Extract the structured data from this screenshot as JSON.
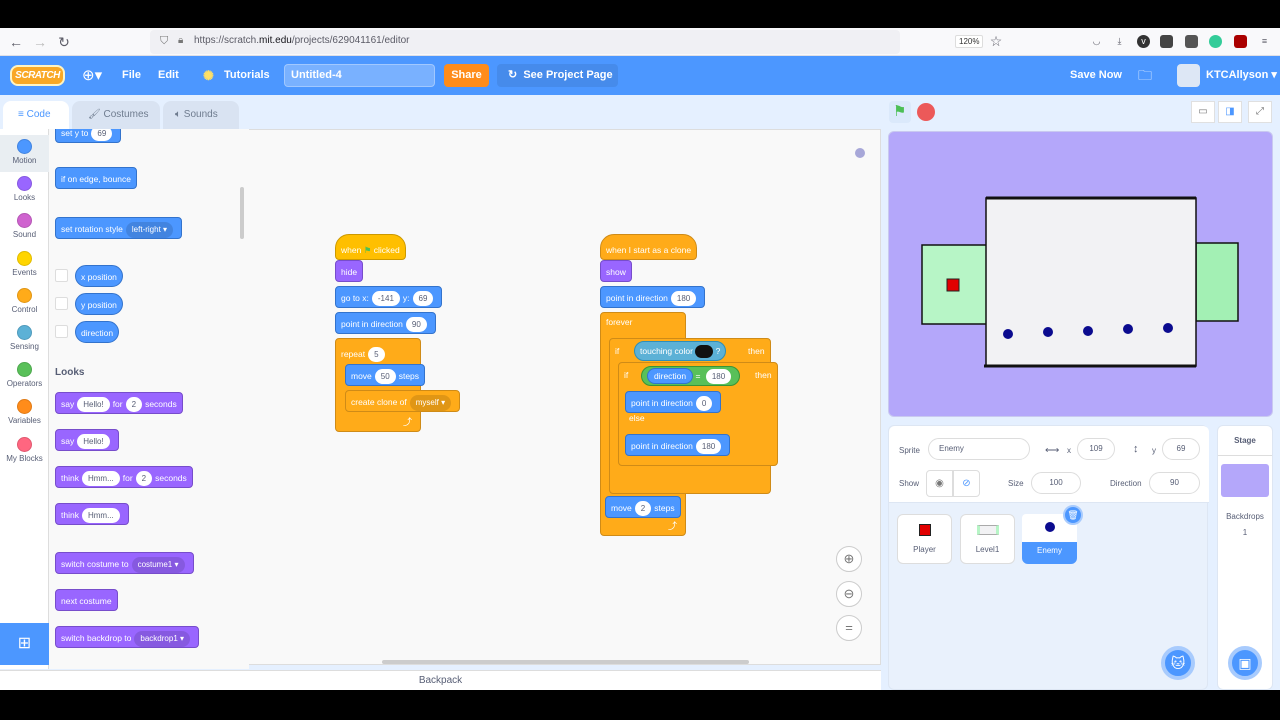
{
  "browser": {
    "url_prefix": "https://scratch.",
    "url_domain": "mit.edu",
    "url_path": "/projects/629041161/editor",
    "zoom_level": "120%"
  },
  "menubar": {
    "logo": "SCRATCH",
    "file": "File",
    "edit": "Edit",
    "tutorials": "Tutorials",
    "project_title": "Untitled-4",
    "share": "Share",
    "see_project_page": "See Project Page",
    "save_now": "Save Now",
    "username": "KTCAllyson"
  },
  "tabs": {
    "code": "Code",
    "costumes": "Costumes",
    "sounds": "Sounds"
  },
  "categories": [
    {
      "label": "Motion",
      "color": "#4c97ff"
    },
    {
      "label": "Looks",
      "color": "#9966ff"
    },
    {
      "label": "Sound",
      "color": "#cf63cf"
    },
    {
      "label": "Events",
      "color": "#ffd500"
    },
    {
      "label": "Control",
      "color": "#ffab19"
    },
    {
      "label": "Sensing",
      "color": "#5cb1d6"
    },
    {
      "label": "Operators",
      "color": "#59c059"
    },
    {
      "label": "Variables",
      "color": "#ff8c1a"
    },
    {
      "label": "My Blocks",
      "color": "#ff6680"
    }
  ],
  "palette": {
    "set_y": {
      "label": "set y to",
      "value": "69"
    },
    "bounce": "if on edge, bounce",
    "rotation": {
      "label": "set rotation style",
      "value": "left-right"
    },
    "reporters": [
      "x position",
      "y position",
      "direction"
    ],
    "looks_header": "Looks",
    "say_for": {
      "a": "say",
      "v1": "Hello!",
      "b": "for",
      "v2": "2",
      "c": "seconds"
    },
    "say": {
      "a": "say",
      "v1": "Hello!"
    },
    "think_for": {
      "a": "think",
      "v1": "Hmm...",
      "b": "for",
      "v2": "2",
      "c": "seconds"
    },
    "think": {
      "a": "think",
      "v1": "Hmm..."
    },
    "switch_costume": {
      "label": "switch costume to",
      "value": "costume1"
    },
    "next_costume": "next costume",
    "switch_backdrop": {
      "label": "switch backdrop to",
      "value": "backdrop1"
    }
  },
  "script1": {
    "hat_a": "when",
    "hat_b": "clicked",
    "hide": "hide",
    "goto": {
      "a": "go to x:",
      "x": "-141",
      "b": "y:",
      "y": "69"
    },
    "point": {
      "label": "point in direction",
      "value": "90"
    },
    "repeat": {
      "label": "repeat",
      "value": "5"
    },
    "move": {
      "a": "move",
      "value": "50",
      "b": "steps"
    },
    "clone": {
      "label": "create clone of",
      "value": "myself"
    }
  },
  "script2": {
    "hat": "when I start as a clone",
    "show": "show",
    "point1": {
      "label": "point in direction",
      "value": "180"
    },
    "forever": "forever",
    "if1": {
      "a": "if",
      "cond": "touching color",
      "q": "?",
      "then": "then"
    },
    "if2": {
      "a": "if",
      "left": "direction",
      "op": "=",
      "right": "180",
      "then": "then"
    },
    "point2": {
      "label": "point in direction",
      "value": "0"
    },
    "else": "else",
    "point3": {
      "label": "point in direction",
      "value": "180"
    },
    "move": {
      "a": "move",
      "value": "2",
      "b": "steps"
    }
  },
  "backpack": "Backpack",
  "sprite_info": {
    "sprite_label": "Sprite",
    "sprite_name": "Enemy",
    "x_label": "x",
    "x": "109",
    "y_label": "y",
    "y": "69",
    "show_label": "Show",
    "size_label": "Size",
    "size": "100",
    "direction_label": "Direction",
    "direction": "90"
  },
  "sprites": [
    {
      "name": "Player",
      "selected": false
    },
    {
      "name": "Level1",
      "selected": false
    },
    {
      "name": "Enemy",
      "selected": true
    }
  ],
  "stage_panel": {
    "title": "Stage",
    "backdrops_label": "Backdrops",
    "backdrops_count": "1"
  }
}
